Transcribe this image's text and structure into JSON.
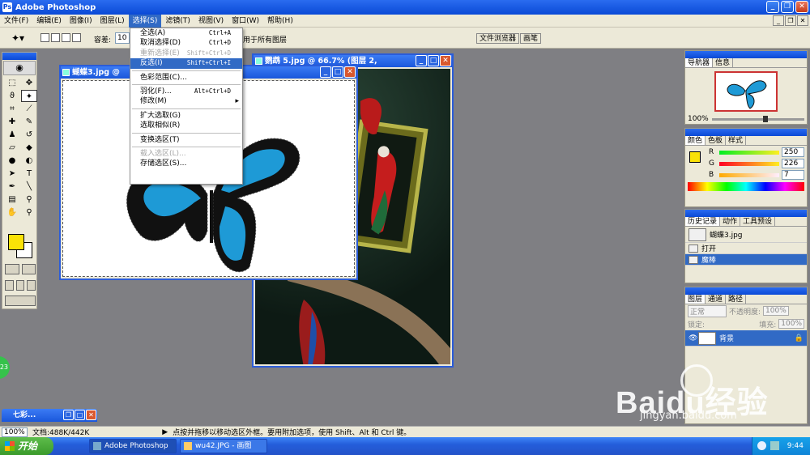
{
  "app": {
    "title": "Adobe Photoshop"
  },
  "menubar": {
    "items": [
      "文件(F)",
      "编辑(E)",
      "图像(I)",
      "图层(L)",
      "选择(S)",
      "滤镜(T)",
      "视图(V)",
      "窗口(W)",
      "帮助(H)"
    ],
    "active_index": 4
  },
  "options": {
    "tolerance_label": "容差:",
    "tolerance_value": "10",
    "all_layers_label": "用于所有图层",
    "well_tabs": [
      "文件浏览器",
      "画笔"
    ]
  },
  "select_menu": {
    "items": [
      {
        "label": "全选(A)",
        "shortcut": "Ctrl+A",
        "state": "normal"
      },
      {
        "label": "取消选择(D)",
        "shortcut": "Ctrl+D",
        "state": "normal"
      },
      {
        "label": "重新选择(E)",
        "shortcut": "Shift+Ctrl+D",
        "state": "disabled"
      },
      {
        "label": "反选(I)",
        "shortcut": "Shift+Ctrl+I",
        "state": "highlighted"
      },
      {
        "sep": true
      },
      {
        "label": "色彩范围(C)...",
        "shortcut": "",
        "state": "normal"
      },
      {
        "sep": true
      },
      {
        "label": "羽化(F)...",
        "shortcut": "Alt+Ctrl+D",
        "state": "normal"
      },
      {
        "label": "修改(M)",
        "shortcut": "",
        "state": "submenu"
      },
      {
        "sep": true
      },
      {
        "label": "扩大选取(G)",
        "shortcut": "",
        "state": "normal"
      },
      {
        "label": "选取相似(R)",
        "shortcut": "",
        "state": "normal"
      },
      {
        "sep": true
      },
      {
        "label": "变换选区(T)",
        "shortcut": "",
        "state": "normal"
      },
      {
        "sep": true
      },
      {
        "label": "载入选区(L)...",
        "shortcut": "",
        "state": "disabled"
      },
      {
        "label": "存储选区(S)...",
        "shortcut": "",
        "state": "normal"
      }
    ]
  },
  "docs": {
    "butterfly": {
      "title": "蝴蝶3.jpg @"
    },
    "parrot": {
      "title": "鹦鹉 5.jpg @ 66.7% (图层 2,"
    }
  },
  "navigator": {
    "tabs": [
      "导航器",
      "信息"
    ],
    "zoom": "100%"
  },
  "color": {
    "tabs": [
      "颜色",
      "色板",
      "样式"
    ],
    "labels": [
      "R",
      "G",
      "B"
    ],
    "values": [
      "250",
      "226",
      "7"
    ],
    "fg": "#fae207"
  },
  "history": {
    "tabs": [
      "历史记录",
      "动作",
      "工具预设"
    ],
    "snapshot": "蝴蝶3.jpg",
    "steps": [
      "打开",
      "魔棒"
    ],
    "active_step": 1
  },
  "layers": {
    "tabs": [
      "图层",
      "通道",
      "路径"
    ],
    "blend": "正常",
    "opacity_label": "不透明度:",
    "opacity": "100%",
    "lock_label": "锁定:",
    "fill_label": "填充:",
    "fill": "100%",
    "layer_name": "背景"
  },
  "minimized": {
    "title": "七彩..."
  },
  "status": {
    "zoom": "100%",
    "doc": "文档:488K/442K",
    "hint": "点按并拖移以移动选区外框。要用附加选项，使用 Shift、Alt 和 Ctrl 键。"
  },
  "taskbar": {
    "start": "开始",
    "tasks": [
      "Adobe Photoshop",
      "wu42.JPG - 画图"
    ],
    "clock": "9:44"
  },
  "badge": {
    "text": "23"
  },
  "watermark": {
    "brand": "Baidu经验",
    "url": "jingyan.baidu.com"
  }
}
